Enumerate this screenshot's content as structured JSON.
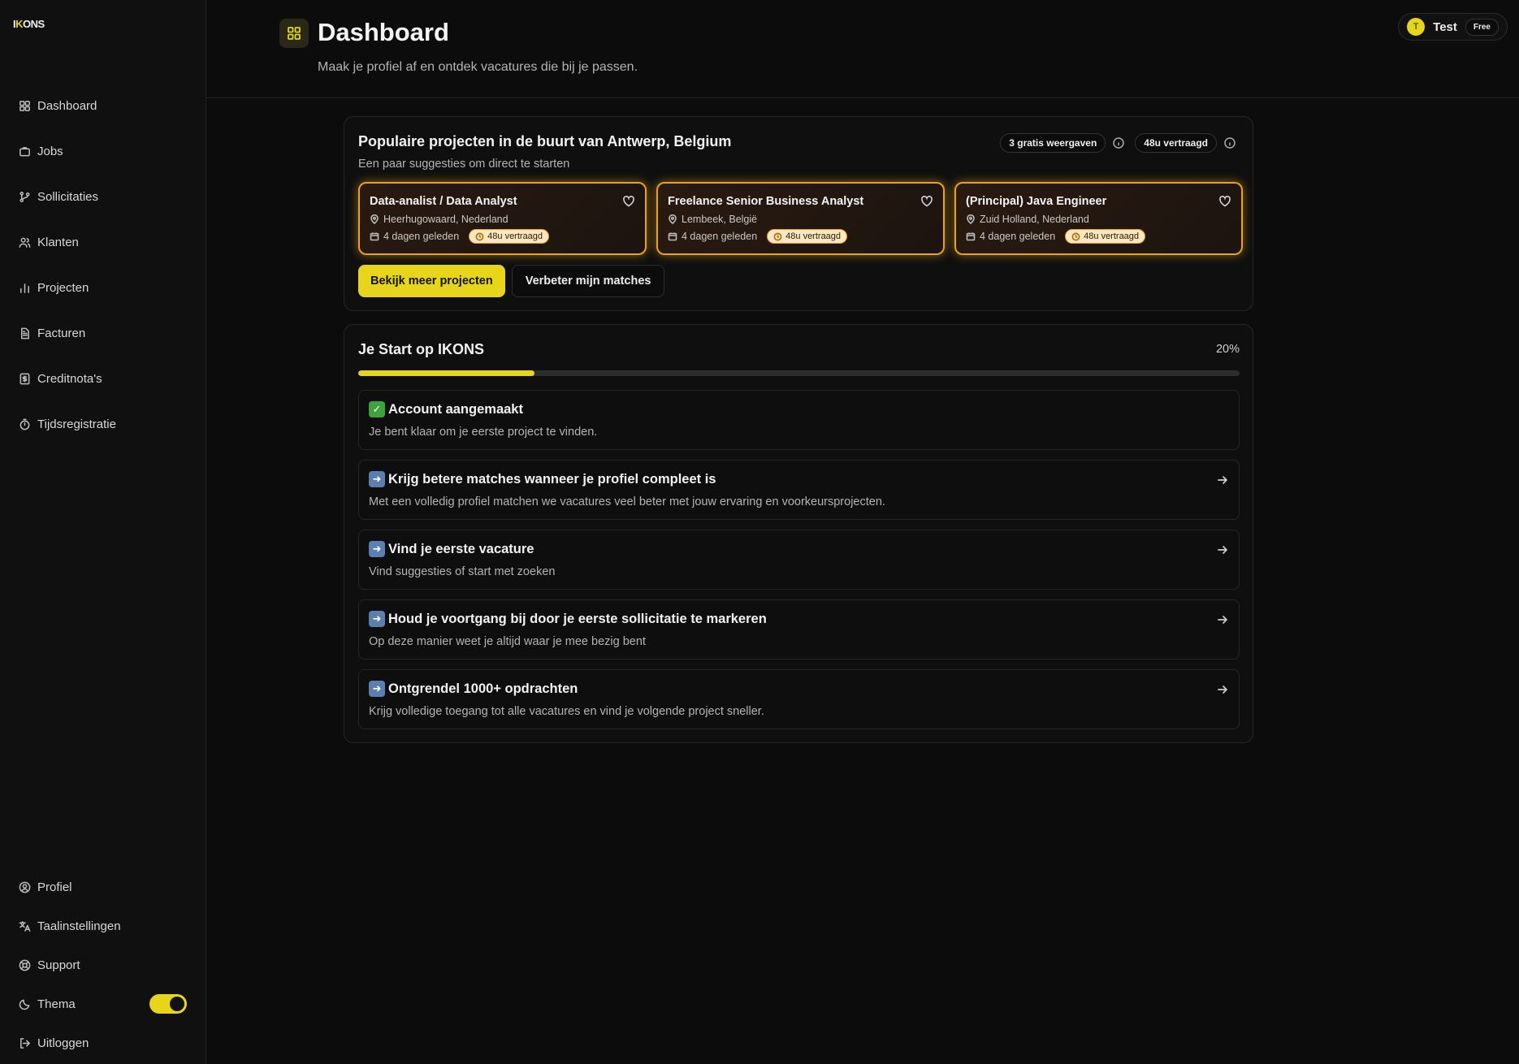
{
  "brand": {
    "logo_pre": "I",
    "logo_k": "K",
    "logo_post": "ONS"
  },
  "sidebar": {
    "items": [
      {
        "label": "Dashboard",
        "icon": "dashboard-icon"
      },
      {
        "label": "Jobs",
        "icon": "briefcase-icon"
      },
      {
        "label": "Sollicitaties",
        "icon": "branch-icon"
      },
      {
        "label": "Klanten",
        "icon": "users-icon"
      },
      {
        "label": "Projecten",
        "icon": "bar-chart-icon"
      },
      {
        "label": "Facturen",
        "icon": "invoice-icon"
      },
      {
        "label": "Creditnota's",
        "icon": "receipt-icon"
      },
      {
        "label": "Tijdsregistratie",
        "icon": "timer-icon"
      }
    ],
    "bottom": [
      {
        "label": "Profiel",
        "icon": "user-circle-icon"
      },
      {
        "label": "Taalinstellingen",
        "icon": "language-icon"
      },
      {
        "label": "Support",
        "icon": "lifebuoy-icon"
      },
      {
        "label": "Thema",
        "icon": "moon-icon"
      },
      {
        "label": "Uitloggen",
        "icon": "logout-icon"
      }
    ],
    "theme_toggle_on": true
  },
  "header": {
    "title": "Dashboard",
    "subtitle": "Maak je profiel af en ontdek vacatures die bij je passen.",
    "user": {
      "initial": "T",
      "name": "Test",
      "plan": "Free"
    }
  },
  "popular": {
    "title": "Populaire projecten in de buurt van Antwerp, Belgium",
    "subtitle": "Een paar suggesties om direct te starten",
    "badge_views": "3 gratis weergaven",
    "badge_delay": "48u vertraagd",
    "jobs": [
      {
        "title": "Data-analist / Data Analyst",
        "location": "Heerhugowaard, Nederland",
        "posted": "4 dagen geleden",
        "delay": "48u vertraagd"
      },
      {
        "title": "Freelance Senior Business Analyst",
        "location": "Lembeek, België",
        "posted": "4 dagen geleden",
        "delay": "48u vertraagd"
      },
      {
        "title": "(Principal) Java Engineer",
        "location": "Zuid Holland, Nederland",
        "posted": "4 dagen geleden",
        "delay": "48u vertraagd"
      }
    ],
    "btn_more": "Bekijk meer projecten",
    "btn_improve": "Verbeter mijn matches"
  },
  "onboarding": {
    "title": "Je Start op IKONS",
    "progress_label": "20%",
    "progress": 0.2,
    "steps": [
      {
        "title": "Account aangemaakt",
        "desc": "Je bent klaar om je eerste project te vinden.",
        "done": true
      },
      {
        "title": "Krijg betere matches wanneer je profiel compleet is",
        "desc": "Met een volledig profiel matchen we vacatures veel beter met jouw ervaring en voorkeursprojecten.",
        "done": false
      },
      {
        "title": "Vind je eerste vacature",
        "desc": "Vind suggesties of start met zoeken",
        "done": false
      },
      {
        "title": "Houd je voortgang bij door je eerste sollicitatie te markeren",
        "desc": "Op deze manier weet je altijd waar je mee bezig bent",
        "done": false
      },
      {
        "title": "Ontgrendel 1000+ opdrachten",
        "desc": "Krijg volledige toegang tot alle vacatures en vind je volgende project sneller.",
        "done": false
      }
    ]
  },
  "colors": {
    "accent": "#e6d51a",
    "job_border": "#e9a21a",
    "background": "#0c0c0c"
  }
}
